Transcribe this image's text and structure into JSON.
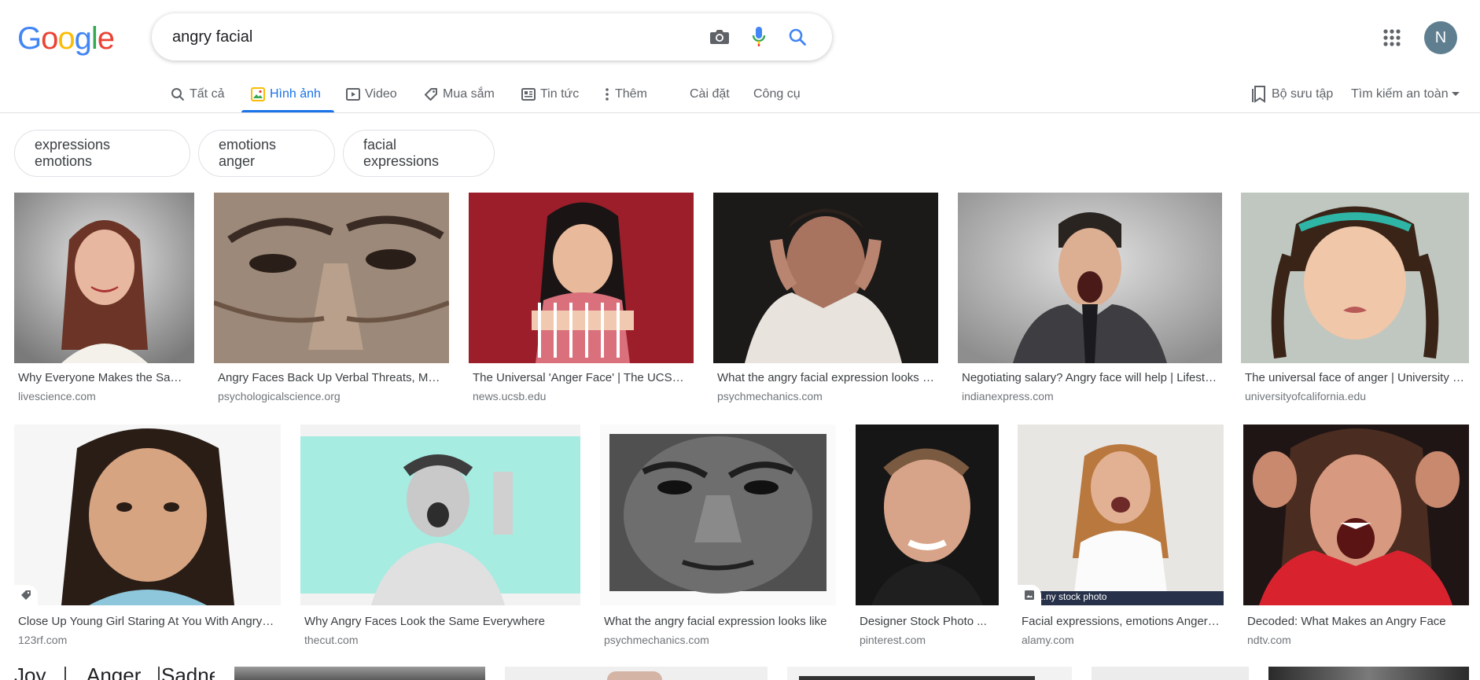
{
  "logo": {
    "letters": [
      "G",
      "o",
      "o",
      "g",
      "l",
      "e"
    ],
    "colors": [
      "#4285F4",
      "#EA4335",
      "#FBBC05",
      "#4285F4",
      "#34A853",
      "#EA4335"
    ]
  },
  "search": {
    "value": "angry facial",
    "placeholder": ""
  },
  "icons": {
    "camera": "camera-icon",
    "mic": "microphone-icon",
    "search": "search-icon",
    "apps": "apps-grid-icon"
  },
  "account": {
    "initial": "N",
    "avatar_color": "#5f7f91"
  },
  "tabs": [
    {
      "label": "Tất cả",
      "icon": "search-icon"
    },
    {
      "label": "Hình ảnh",
      "icon": "image-icon",
      "active": true
    },
    {
      "label": "Video",
      "icon": "video-icon"
    },
    {
      "label": "Mua sắm",
      "icon": "tag-icon"
    },
    {
      "label": "Tin tức",
      "icon": "news-icon"
    },
    {
      "label": "Thêm",
      "icon": "more-vert-icon"
    },
    {
      "label": "Cài đặt"
    },
    {
      "label": "Công cụ"
    }
  ],
  "right_tabs": {
    "collections": "Bộ sưu tập",
    "safe_search": "Tìm kiếm an toàn"
  },
  "chips": [
    "expressions emotions",
    "emotions anger",
    "facial expressions"
  ],
  "row1": [
    {
      "caption": "Why Everyone Makes the Same Angry Face",
      "domain": "livescience.com"
    },
    {
      "caption": "Angry Faces Back Up Verbal Threats, Making Them More Convincing",
      "domain": "psychologicalscience.org"
    },
    {
      "caption": "The Universal 'Anger Face' | The UCSB Current",
      "domain": "news.ucsb.edu"
    },
    {
      "caption": "What the angry facial expression looks like",
      "domain": "psychmechanics.com"
    },
    {
      "caption": "Negotiating salary? Angry face will help | Lifestyle News",
      "domain": "indianexpress.com"
    },
    {
      "caption": "The universal face of anger | University of California",
      "domain": "universityofcalifornia.edu"
    }
  ],
  "row2": [
    {
      "caption": "Close Up Young Girl Staring At You With Angry Facial Expression",
      "domain": "123rf.com"
    },
    {
      "caption": "Why Angry Faces Look the Same Everywhere",
      "domain": "thecut.com"
    },
    {
      "caption": "What the angry facial expression looks like",
      "domain": "psychmechanics.com"
    },
    {
      "caption": "Designer Stock Photo ...",
      "domain": "pinterest.com"
    },
    {
      "caption": "Facial expressions, emotions Anger ...",
      "domain": "alamy.com",
      "overlay": "...ny stock photo"
    },
    {
      "caption": "Decoded: What Makes an Angry Face",
      "domain": "ndtv.com"
    }
  ],
  "row3_text": [
    "Joy",
    "Anger",
    "Sadne"
  ]
}
